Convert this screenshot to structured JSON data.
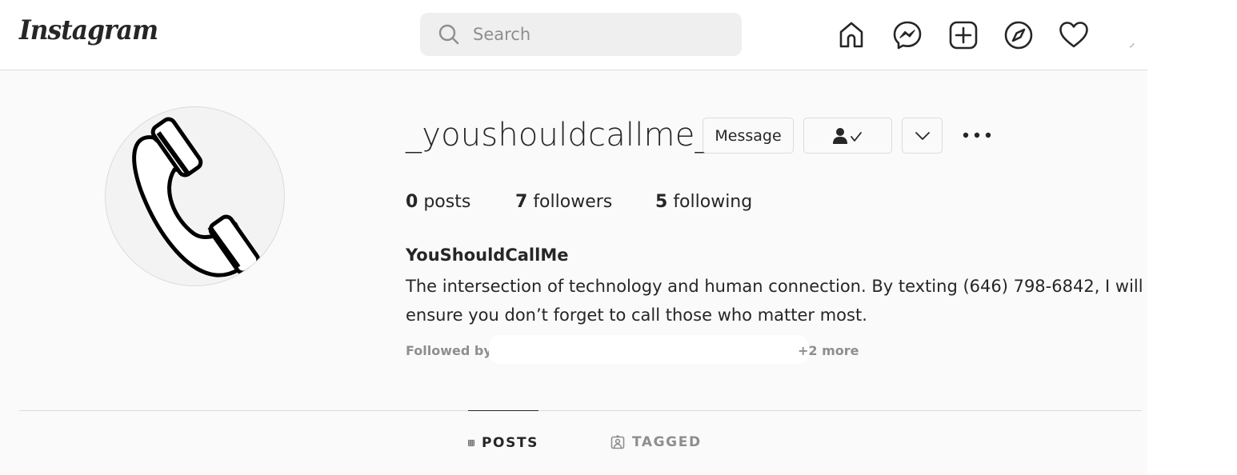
{
  "header": {
    "logo_text": "Instagram",
    "search": {
      "placeholder": "Search",
      "value": ""
    },
    "nav_icons": [
      "home-icon",
      "messenger-icon",
      "new-post-icon",
      "explore-icon",
      "activity-heart-icon"
    ]
  },
  "profile": {
    "username": "_youshouldcallme_",
    "avatar_icon": "phone-handset-icon",
    "actions": {
      "message_label": "Message",
      "following_icon": "person-check-icon",
      "dropdown_icon": "chevron-down-icon",
      "more_icon": "more-options-icon"
    },
    "stats": {
      "posts_count": "0",
      "posts_label": "posts",
      "followers_count": "7",
      "followers_label": "followers",
      "following_count": "5",
      "following_label": "following"
    },
    "full_name": "YouShouldCallMe",
    "bio": "The intersection of technology and human connection. By texting (646) 798-6842, I will ensure you don’t forget to call those who matter most.",
    "followed_by_label": "Followed by",
    "followed_by_more": "+2 more"
  },
  "tabs": [
    {
      "label": "POSTS",
      "icon": "grid-icon",
      "active": true
    },
    {
      "label": "TAGGED",
      "icon": "tagged-icon",
      "active": false
    }
  ],
  "colors": {
    "background": "#fafafa",
    "text": "#262626",
    "muted": "#8e8e8e",
    "border": "#dbdbdb",
    "search_bg": "#efefef"
  }
}
